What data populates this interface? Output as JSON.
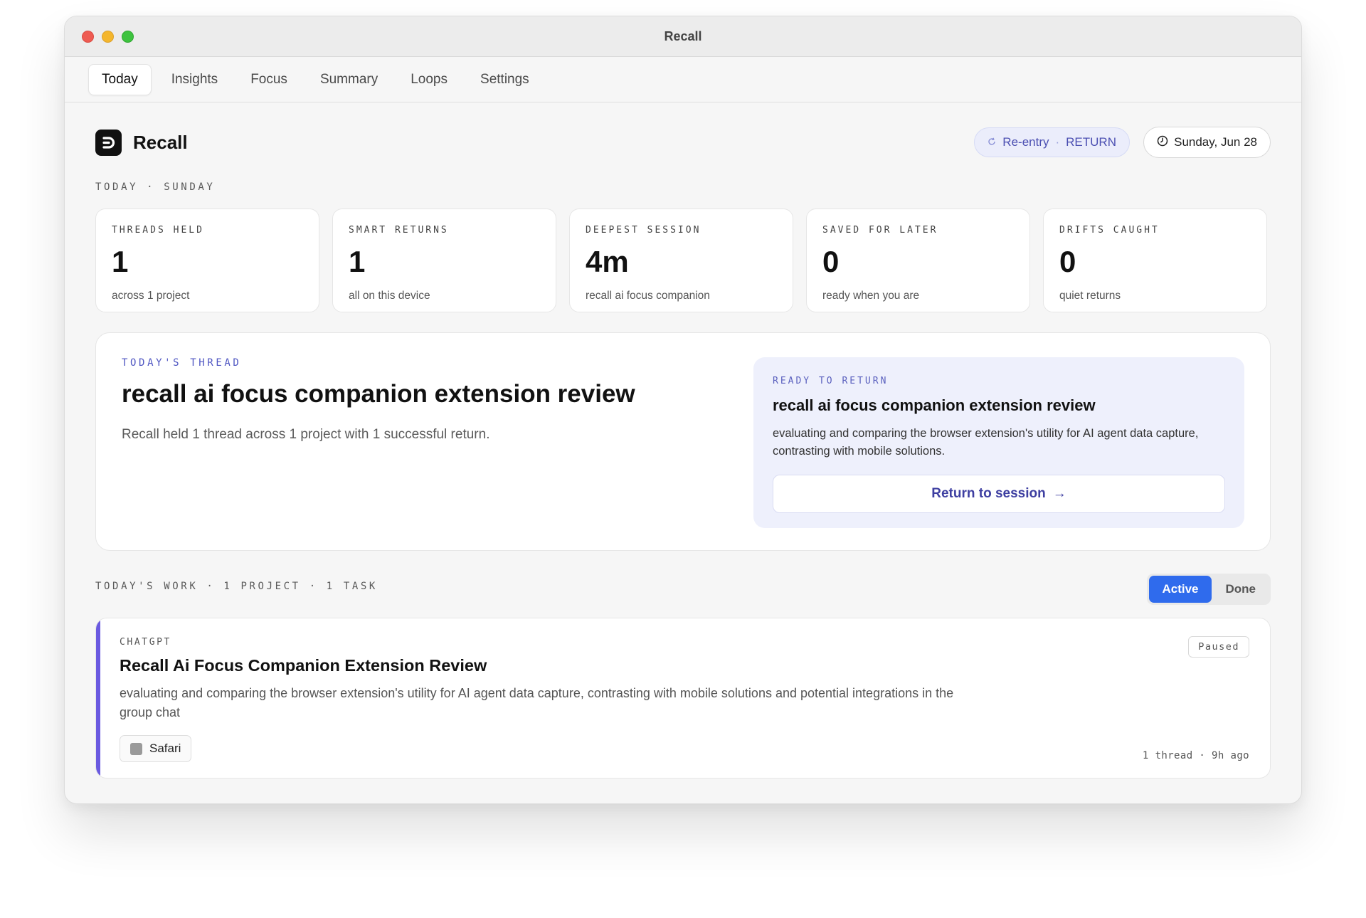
{
  "window": {
    "title": "Recall"
  },
  "tabs": [
    {
      "label": "Today",
      "active": true
    },
    {
      "label": "Insights"
    },
    {
      "label": "Focus"
    },
    {
      "label": "Summary"
    },
    {
      "label": "Loops"
    },
    {
      "label": "Settings"
    }
  ],
  "header": {
    "app_name": "Recall",
    "reentry_label": "Re-entry",
    "reentry_separator": "·",
    "reentry_mode": "RETURN",
    "date": "Sunday, Jun 28"
  },
  "day_label": "TODAY · SUNDAY",
  "stats": [
    {
      "label": "THREADS HELD",
      "value": "1",
      "sub": "across 1 project"
    },
    {
      "label": "SMART RETURNS",
      "value": "1",
      "sub": "all on this device"
    },
    {
      "label": "DEEPEST SESSION",
      "value": "4m",
      "sub": "recall ai focus companion"
    },
    {
      "label": "SAVED FOR LATER",
      "value": "0",
      "sub": "ready when you are"
    },
    {
      "label": "DRIFTS CAUGHT",
      "value": "0",
      "sub": "quiet returns"
    }
  ],
  "thread": {
    "kicker": "TODAY'S THREAD",
    "title": "recall ai focus companion extension review",
    "description": "Recall held 1 thread across 1 project with 1 successful return.",
    "ready": {
      "kicker": "READY TO RETURN",
      "title": "recall ai focus companion extension review",
      "description": "evaluating and comparing the browser extension's utility for AI agent data capture, contrasting with mobile solutions.",
      "button_label": "Return to session",
      "button_arrow": "→"
    }
  },
  "work": {
    "label": "TODAY'S WORK · 1 PROJECT · 1 TASK",
    "segments": [
      {
        "label": "Active",
        "active": true
      },
      {
        "label": "Done"
      }
    ]
  },
  "task": {
    "source": "CHATGPT",
    "title": "Recall Ai Focus Companion Extension Review",
    "description": "evaluating and comparing the browser extension's utility for AI agent data capture, contrasting with mobile solutions and potential integrations in the group chat",
    "app_chip": "Safari",
    "status": "Paused",
    "meta": "1 thread · 9h ago"
  },
  "colors": {
    "accent_blue": "#2f6bed",
    "indigo": "#4f56c2",
    "task_accent": "#6a5ae0"
  }
}
